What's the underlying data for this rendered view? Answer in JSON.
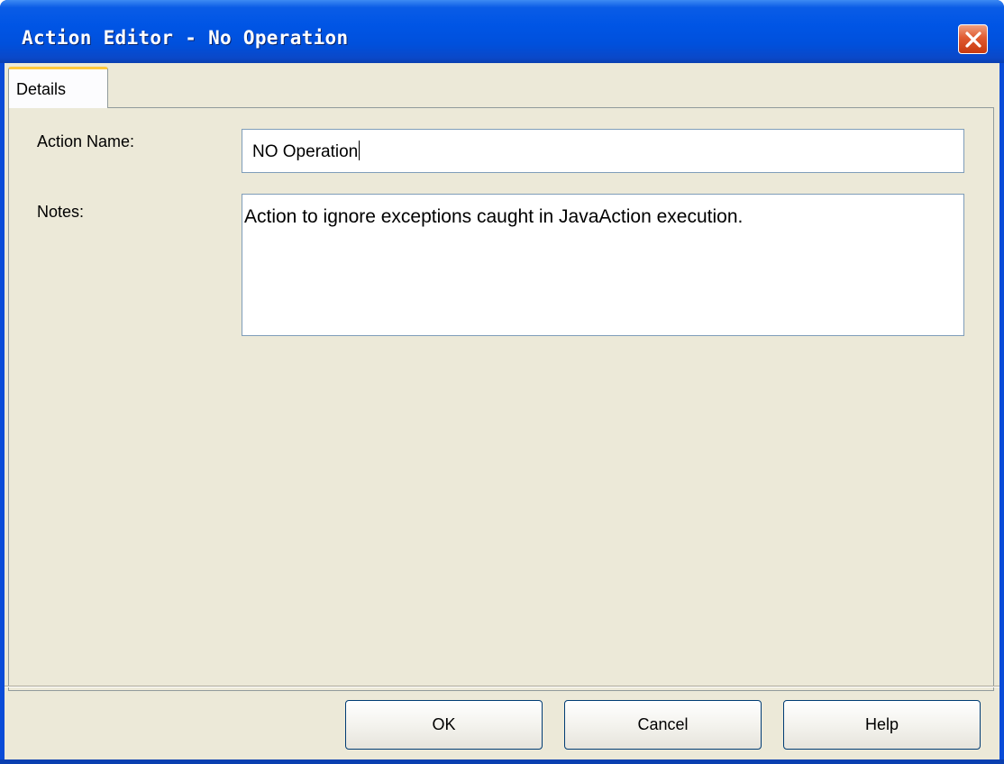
{
  "window": {
    "title": "Action Editor - No Operation",
    "close_icon": "close-x-icon"
  },
  "tabs": [
    {
      "label": "Details",
      "selected": true
    }
  ],
  "form": {
    "action_name_label": "Action Name:",
    "action_name_value": "NO Operation",
    "notes_label": "Notes:",
    "notes_value": "Action to ignore exceptions caught in JavaAction execution."
  },
  "buttons": {
    "ok": "OK",
    "cancel": "Cancel",
    "help": "Help"
  },
  "colors": {
    "titlebar": "#0055e5",
    "client_bg": "#ece9d8",
    "close_button": "#e05a30",
    "tab_highlight": "#ffc83c"
  }
}
